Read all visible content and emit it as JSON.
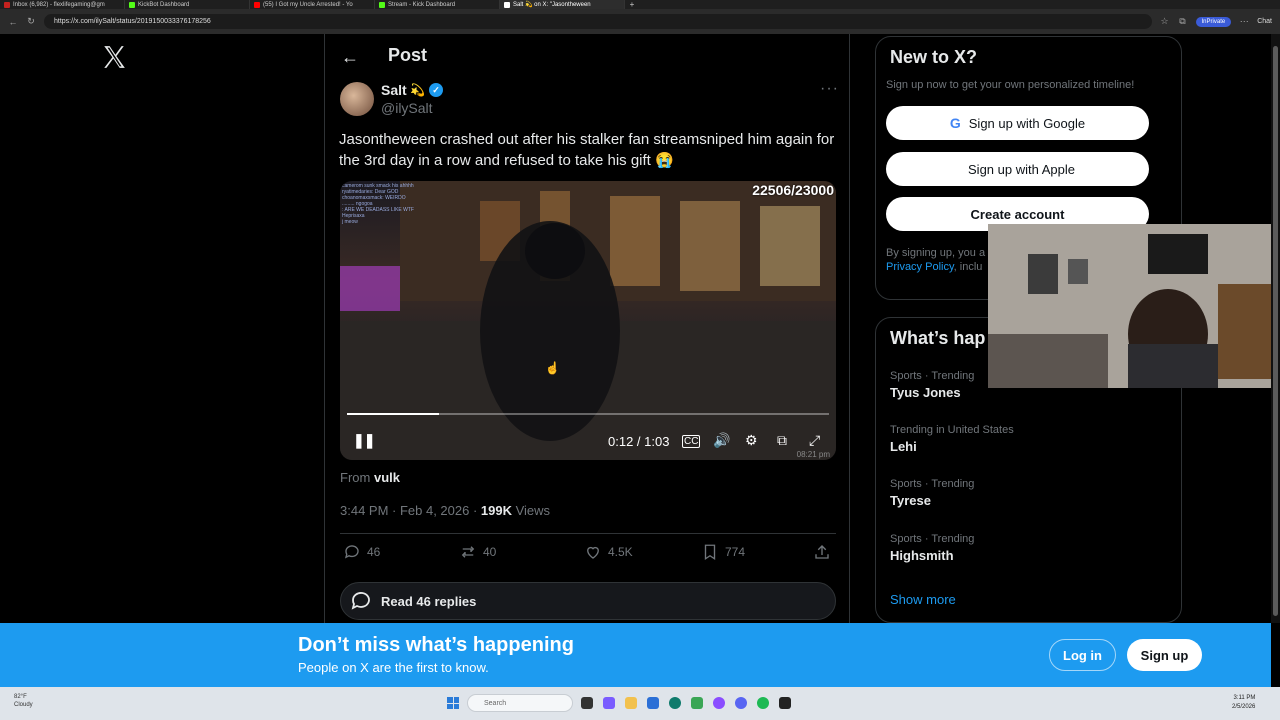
{
  "browser": {
    "tabs": [
      {
        "label": "Inbox (6,982) - flexlifegaming@gm",
        "color": "#c5221f"
      },
      {
        "label": "KickBot Dashboard",
        "color": "#53fc18"
      },
      {
        "label": "(55) I Got my Uncle Arrested! - Yo",
        "color": "#ff0000"
      },
      {
        "label": "Stream - Kick Dashboard",
        "color": "#53fc18"
      },
      {
        "label": "Salt 💫 on X: \"Jasontheween",
        "color": "#ffffff"
      }
    ],
    "url": "https://x.com/ilySalt/status/2019150033376178256",
    "inprivate_label": "InPrivate",
    "chat_label": "Chat"
  },
  "header": {
    "title": "Post"
  },
  "post": {
    "display_name": "Salt",
    "handle": "@ilySalt",
    "text": "Jasontheween crashed out after his stalker fan streamsniped him again for the 3rd day in a row and refused to take his gift 😭",
    "video": {
      "overlay_counter": "22506/23000",
      "chat_lines": [
        "camerom sunk smack his ahhhh",
        "ryatimedaries: Dear GOD",
        "choanomaxsmack: WEIRDO",
        "......... ngogoa",
        ": ARE WE DEADASS LIKE WTF",
        "Heprisaxa",
        "j meow"
      ],
      "time": "0:12 / 1:03",
      "progress": 0.19,
      "timestamp": "08:21 pm"
    },
    "from_label": "From",
    "from_source": "vulk",
    "time_date": "3:44 PM · Feb 4, 2026 · ",
    "views_count": "199K",
    "views_label": " Views",
    "replies": "46",
    "reposts": "40",
    "likes": "4.5K",
    "bookmarks": "774",
    "read_replies_label": "Read 46 replies"
  },
  "signup_card": {
    "title": "New to X?",
    "subtitle": "Sign up now to get your own personalized timeline!",
    "google_label": "Sign up with Google",
    "apple_label": "Sign up with Apple",
    "create_label": "Create account",
    "terms_prefix": "By signing up, you a",
    "privacy_label": "Privacy Policy",
    "terms_suffix": ", inclu"
  },
  "trends": {
    "title": "What’s hap",
    "items": [
      {
        "category": "Sports · Trending",
        "name": "Tyus Jones"
      },
      {
        "category": "Trending in United States",
        "name": "Lehi"
      },
      {
        "category": "Sports · Trending",
        "name": "Tyrese"
      },
      {
        "category": "Sports · Trending",
        "name": "Highsmith"
      }
    ],
    "show_more": "Show more"
  },
  "banner": {
    "title": "Don’t miss what’s happening",
    "subtitle": "People on X are the first to know.",
    "login": "Log in",
    "signup": "Sign up"
  },
  "taskbar": {
    "temp": "82°F",
    "weather": "Cloudy",
    "search_placeholder": "Search",
    "time": "3:11 PM",
    "date": "2/5/2026"
  }
}
